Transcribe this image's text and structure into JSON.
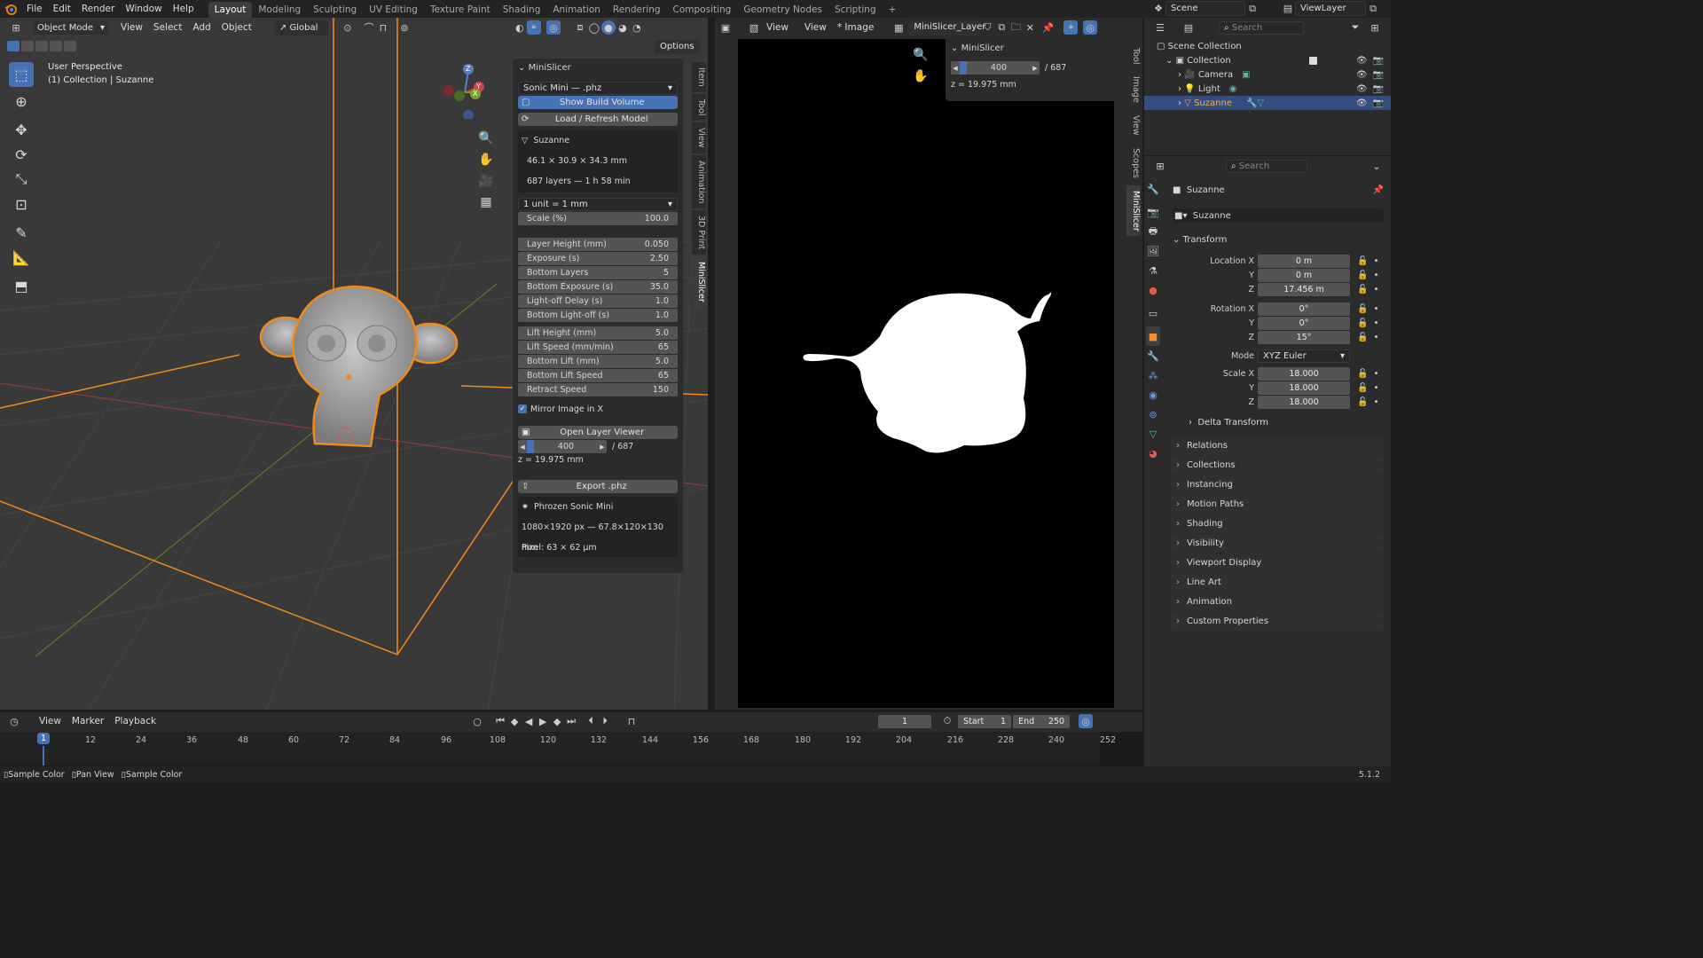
{
  "topbar": {
    "menus": [
      "File",
      "Edit",
      "Render",
      "Window",
      "Help"
    ],
    "workspaces": [
      "Layout",
      "Modeling",
      "Sculpting",
      "UV Editing",
      "Texture Paint",
      "Shading",
      "Animation",
      "Rendering",
      "Compositing",
      "Geometry Nodes",
      "Scripting"
    ],
    "active_workspace": "Layout",
    "add": "+",
    "scene": "Scene",
    "view_layer": "ViewLayer"
  },
  "viewport": {
    "mode": "Object Mode",
    "menus": [
      "View",
      "Select",
      "Add",
      "Object"
    ],
    "orientation": "Global",
    "options": "Options",
    "overlay_title": "User Perspective",
    "overlay_sub": "(1) Collection | Suzanne",
    "gizmo": {
      "x": "X",
      "y": "Y",
      "z": "Z"
    }
  },
  "minislicer": {
    "title": "MiniSlicer",
    "printer": "Sonic Mini — .phz",
    "show_build_volume": "Show Build Volume",
    "load_refresh": "Load / Refresh Model",
    "object": "Suzanne",
    "dimensions": "46.1 × 30.9 × 34.3 mm",
    "layers_time": "687 layers — 1 h 58 min",
    "unit": "1 unit = 1 mm",
    "scale_label": "Scale (%)",
    "scale_value": "100.0",
    "params": [
      {
        "label": "Layer Height (mm)",
        "value": "0.050"
      },
      {
        "label": "Exposure (s)",
        "value": "2.50"
      },
      {
        "label": "Bottom Layers",
        "value": "5"
      },
      {
        "label": "Bottom Exposure (s)",
        "value": "35.0"
      },
      {
        "label": "Light-off Delay (s)",
        "value": "1.0"
      },
      {
        "label": "Bottom Light-off (s)",
        "value": "1.0"
      }
    ],
    "motion": [
      {
        "label": "Lift Height (mm)",
        "value": "5.0"
      },
      {
        "label": "Lift Speed (mm/min)",
        "value": "65"
      },
      {
        "label": "Bottom Lift (mm)",
        "value": "5.0"
      },
      {
        "label": "Bottom Lift Speed",
        "value": "65"
      },
      {
        "label": "Retract Speed",
        "value": "150"
      }
    ],
    "mirror": "Mirror Image in X",
    "open_viewer": "Open Layer Viewer",
    "layer": "400",
    "layer_total": "/ 687",
    "z": "z = 19.975 mm",
    "export": "Export .phz",
    "printer_name": "Phrozen Sonic Mini",
    "resolution": "1080×1920 px — 67.8×120×130 mm",
    "pixel": "Pixel: 63 × 62 µm"
  },
  "sidetabs": [
    "Item",
    "Tool",
    "View",
    "Animation",
    "3D Print",
    "MiniSlicer"
  ],
  "image_editor": {
    "menus": [
      "View",
      "View",
      "* Image"
    ],
    "image_name": "MiniSlicer_Layer",
    "panel_title": "MiniSlicer",
    "layer": "400",
    "layer_total": "/ 687",
    "z": "z = 19.975 mm",
    "tabs": [
      "Tool",
      "Image",
      "View",
      "Scopes",
      "MiniSlicer"
    ]
  },
  "outliner": {
    "search": "Search",
    "root": "Scene Collection",
    "collection": "Collection",
    "items": [
      "Camera",
      "Light",
      "Suzanne"
    ]
  },
  "properties": {
    "search": "Search",
    "object": "Suzanne",
    "data_name": "Suzanne",
    "transform": "Transform",
    "location": [
      {
        "label": "Location X",
        "value": "0 m"
      },
      {
        "label": "Y",
        "value": "0 m"
      },
      {
        "label": "Z",
        "value": "17.456 m"
      }
    ],
    "rotation": [
      {
        "label": "Rotation X",
        "value": "0°"
      },
      {
        "label": "Y",
        "value": "0°"
      },
      {
        "label": "Z",
        "value": "15°"
      }
    ],
    "mode_label": "Mode",
    "mode_value": "XYZ Euler",
    "scale": [
      {
        "label": "Scale X",
        "value": "18.000"
      },
      {
        "label": "Y",
        "value": "18.000"
      },
      {
        "label": "Z",
        "value": "18.000"
      }
    ],
    "delta": "Delta Transform",
    "sections": [
      "Relations",
      "Collections",
      "Instancing",
      "Motion Paths",
      "Shading",
      "Visibility",
      "Viewport Display",
      "Line Art",
      "Animation",
      "Custom Properties"
    ]
  },
  "timeline": {
    "menus": [
      "View",
      "Marker",
      "Playback"
    ],
    "current": "1",
    "start_label": "Start",
    "start": "1",
    "end_label": "End",
    "end": "250",
    "ticks": [
      "1",
      "12",
      "24",
      "36",
      "48",
      "60",
      "72",
      "84",
      "96",
      "108",
      "120",
      "132",
      "144",
      "156",
      "168",
      "180",
      "192",
      "204",
      "216",
      "228",
      "240",
      "252"
    ]
  },
  "statusbar": {
    "items": [
      "Sample Color",
      "Pan View",
      "Sample Color"
    ],
    "version": "5.1.2"
  },
  "colors": {
    "accent": "#4772b3",
    "selection": "#ff9b28",
    "bg": "#393939"
  }
}
